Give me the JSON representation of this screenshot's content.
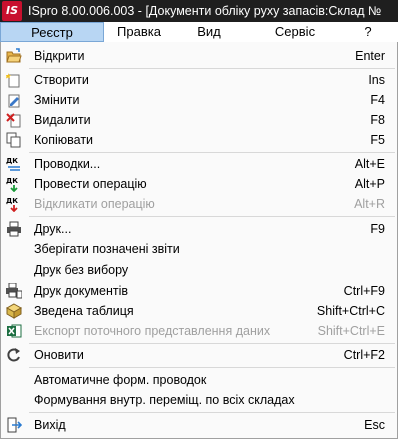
{
  "window": {
    "logo_text": "IS",
    "title": "ISpro 8.00.006.003 - [Документи обліку руху запасів:Склад №"
  },
  "menubar": {
    "items": [
      {
        "label": "Реєстр"
      },
      {
        "label": "Правка"
      },
      {
        "label": "Вид"
      },
      {
        "label": "Сервіс"
      },
      {
        "label": "?"
      }
    ]
  },
  "menu": {
    "items": [
      {
        "label": "Відкрити",
        "shortcut": "Enter",
        "icon": "open-icon",
        "enabled": true
      },
      {
        "label": "Створити",
        "shortcut": "Ins",
        "icon": "create-icon",
        "enabled": true
      },
      {
        "label": "Змінити",
        "shortcut": "F4",
        "icon": "edit-icon",
        "enabled": true
      },
      {
        "label": "Видалити",
        "shortcut": "F8",
        "icon": "delete-icon",
        "enabled": true
      },
      {
        "label": "Копіювати",
        "shortcut": "F5",
        "icon": "copy-icon",
        "enabled": true
      },
      {
        "label": "Проводки...",
        "shortcut": "Alt+E",
        "icon": "postings-icon",
        "enabled": true
      },
      {
        "label": "Провести операцію",
        "shortcut": "Alt+P",
        "icon": "post-operation-icon",
        "enabled": true
      },
      {
        "label": "Відкликати операцію",
        "shortcut": "Alt+R",
        "icon": "revoke-operation-icon",
        "enabled": false
      },
      {
        "label": "Друк...",
        "shortcut": "F9",
        "icon": "print-icon",
        "enabled": true
      },
      {
        "label": "Зберігати позначені звіти",
        "shortcut": "",
        "icon": "",
        "enabled": true
      },
      {
        "label": "Друк без вибору",
        "shortcut": "",
        "icon": "",
        "enabled": true
      },
      {
        "label": "Друк документів",
        "shortcut": "Ctrl+F9",
        "icon": "print-documents-icon",
        "enabled": true
      },
      {
        "label": "Зведена таблиця",
        "shortcut": "Shift+Ctrl+C",
        "icon": "pivot-table-icon",
        "enabled": true
      },
      {
        "label": "Експорт поточного представлення даних",
        "shortcut": "Shift+Ctrl+E",
        "icon": "excel-export-icon",
        "enabled": false
      },
      {
        "label": "Оновити",
        "shortcut": "Ctrl+F2",
        "icon": "refresh-icon",
        "enabled": true
      },
      {
        "label": "Автоматичне форм. проводок",
        "shortcut": "",
        "icon": "",
        "enabled": true
      },
      {
        "label": "Формування внутр. перемiщ. по всіх складах",
        "shortcut": "",
        "icon": "",
        "enabled": true
      },
      {
        "label": "Вихід",
        "shortcut": "Esc",
        "icon": "exit-icon",
        "enabled": true
      }
    ]
  },
  "colors": {
    "titlebar_bg": "#1f1f1f",
    "logo_red": "#c8102e",
    "menu_active_bg": "#b8d6f3",
    "disabled_text": "#a0a0a0"
  }
}
